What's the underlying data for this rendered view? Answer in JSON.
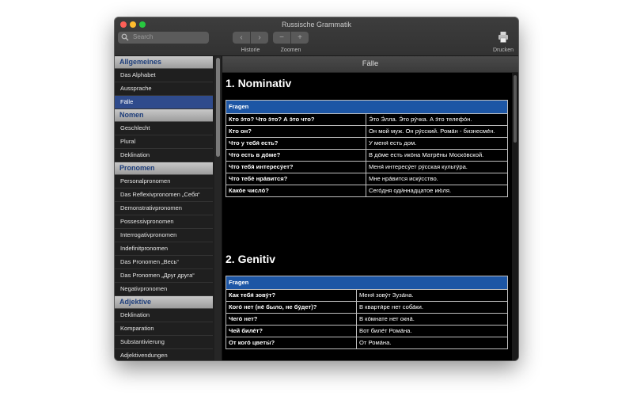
{
  "window": {
    "title": "Russische Grammatik"
  },
  "toolbar": {
    "search_placeholder": "Search",
    "back_icon": "‹",
    "forward_icon": "›",
    "zoom_out_icon": "−",
    "zoom_in_icon": "+",
    "history_label": "Historie",
    "zoom_label": "Zoomen",
    "print_label": "Drucken"
  },
  "sidebar": {
    "sections": [
      {
        "title": "Allgemeines",
        "items": [
          {
            "label": "Das Alphabet",
            "selected": false
          },
          {
            "label": "Aussprache",
            "selected": false
          },
          {
            "label": "Fälle",
            "selected": true
          }
        ]
      },
      {
        "title": "Nomen",
        "items": [
          {
            "label": "Geschlecht",
            "selected": false
          },
          {
            "label": "Plural",
            "selected": false
          },
          {
            "label": "Deklination",
            "selected": false
          }
        ]
      },
      {
        "title": "Pronomen",
        "items": [
          {
            "label": "Personalpronomen",
            "selected": false
          },
          {
            "label": "Das Reflexivpronomen „Себя“",
            "selected": false
          },
          {
            "label": "Demonstrativpronomen",
            "selected": false
          },
          {
            "label": "Possessivpronomen",
            "selected": false
          },
          {
            "label": "Interrogativpronomen",
            "selected": false
          },
          {
            "label": "Indefinitpronomen",
            "selected": false
          },
          {
            "label": "Das Pronomen „Весь“",
            "selected": false
          },
          {
            "label": "Das Pronomen „Друг друга“",
            "selected": false
          },
          {
            "label": "Negativpronomen",
            "selected": false
          }
        ]
      },
      {
        "title": "Adjektive",
        "items": [
          {
            "label": "Deklination",
            "selected": false
          },
          {
            "label": "Komparation",
            "selected": false
          },
          {
            "label": "Substantivierung",
            "selected": false
          },
          {
            "label": "Adjektivendungen",
            "selected": false
          }
        ]
      }
    ]
  },
  "content": {
    "header": "Fälle",
    "cases": [
      {
        "title": "1. Nominativ",
        "table_header": "Fragen",
        "rows": [
          {
            "q": "Кто э́то? Что э́то? А э́то что?",
            "a": "Э́то Э́лла. Э́то ру́чка. А э́то телефо́н."
          },
          {
            "q": "Кто он?",
            "a": "Он мой муж. Он ру́сский. Рома́н - бизнесме́н."
          },
          {
            "q": "Что у тебя́ есть?",
            "a": "У меня́ есть дом."
          },
          {
            "q": "Что есть в до́ме?",
            "a": "В до́ме есть ико́на Матрёны Моско́вской."
          },
          {
            "q": "Что тебя́ интересу́ет?",
            "a": "Меня́ интересу́ет ру́сская культу́ра."
          },
          {
            "q": "Что тебе́ нра́вится?",
            "a": "Мне нра́вится иску́сство."
          },
          {
            "q": "Како́е число́?",
            "a": "Сего́дня оди́ннадцатое ию́ля."
          }
        ]
      },
      {
        "title": "2. Genitiv",
        "table_header": "Fragen",
        "rows": [
          {
            "q": "Как тебя́ зову́т?",
            "a": "Меня́ зову́т Зуза́на."
          },
          {
            "q": "Кого́ нет (не́ было, не бу́дет)?",
            "a": "В кварти́ре нет соба́ки."
          },
          {
            "q": "Чего́ нет?",
            "a": "В ко́мнате нет окна́."
          },
          {
            "q": "Чей биле́т?",
            "a": "Вот биле́т Рома́на."
          },
          {
            "q": "От кого́ цветы́?",
            "a": "От Рома́на."
          }
        ]
      }
    ]
  }
}
